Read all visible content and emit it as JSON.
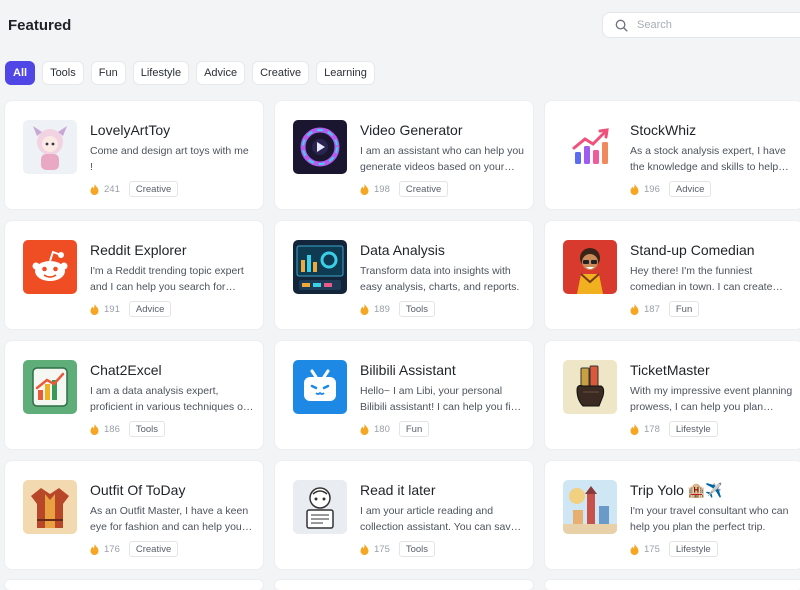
{
  "header": {
    "title": "Featured",
    "search_placeholder": "Search"
  },
  "tabs": [
    "All",
    "Tools",
    "Fun",
    "Lifestyle",
    "Advice",
    "Creative",
    "Learning"
  ],
  "cards": [
    {
      "name": "LovelyArtToy",
      "desc": "Come and design art toys with me !",
      "count": "241",
      "tag": "Creative"
    },
    {
      "name": "Video Generator",
      "desc": "I am an assistant who can help you generate videos based on your input.",
      "count": "198",
      "tag": "Creative"
    },
    {
      "name": "StockWhiz",
      "desc": "As a stock analysis expert, I have the knowledge and skills to help you.",
      "count": "196",
      "tag": "Advice"
    },
    {
      "name": "Reddit Explorer",
      "desc": "I'm a Reddit trending topic expert and I can help you search for topics.",
      "count": "191",
      "tag": "Advice"
    },
    {
      "name": "Data Analysis",
      "desc": "Transform data into insights with easy analysis, charts, and reports.",
      "count": "189",
      "tag": "Tools"
    },
    {
      "name": "Stand-up Comedian",
      "desc": "Hey there! I'm the funniest comedian in town. I can create jokes for you.",
      "count": "187",
      "tag": "Fun"
    },
    {
      "name": "Chat2Excel",
      "desc": "I am a data analysis expert, proficient in various techniques of analysis.",
      "count": "186",
      "tag": "Tools"
    },
    {
      "name": "Bilibili Assistant",
      "desc": "Hello~ I am Libi, your personal Bilibili assistant! I can help you find videos.",
      "count": "180",
      "tag": "Fun"
    },
    {
      "name": "TicketMaster",
      "desc": "With my impressive event planning prowess, I can help you plan events.",
      "count": "178",
      "tag": "Lifestyle"
    },
    {
      "name": "Outfit Of ToDay",
      "desc": "As an Outfit Master, I have a keen eye for fashion and can help you dress.",
      "count": "176",
      "tag": "Creative"
    },
    {
      "name": "Read it later",
      "desc": "I am your article reading and collection assistant. You can save articles.",
      "count": "175",
      "tag": "Tools"
    },
    {
      "name": "Trip Yolo 🏨✈️",
      "desc": "I'm your travel consultant who can help you plan the perfect trip.",
      "count": "175",
      "tag": "Lifestyle"
    }
  ],
  "colors": {
    "accent": "#4f46e5",
    "flame": "#f5a623"
  }
}
